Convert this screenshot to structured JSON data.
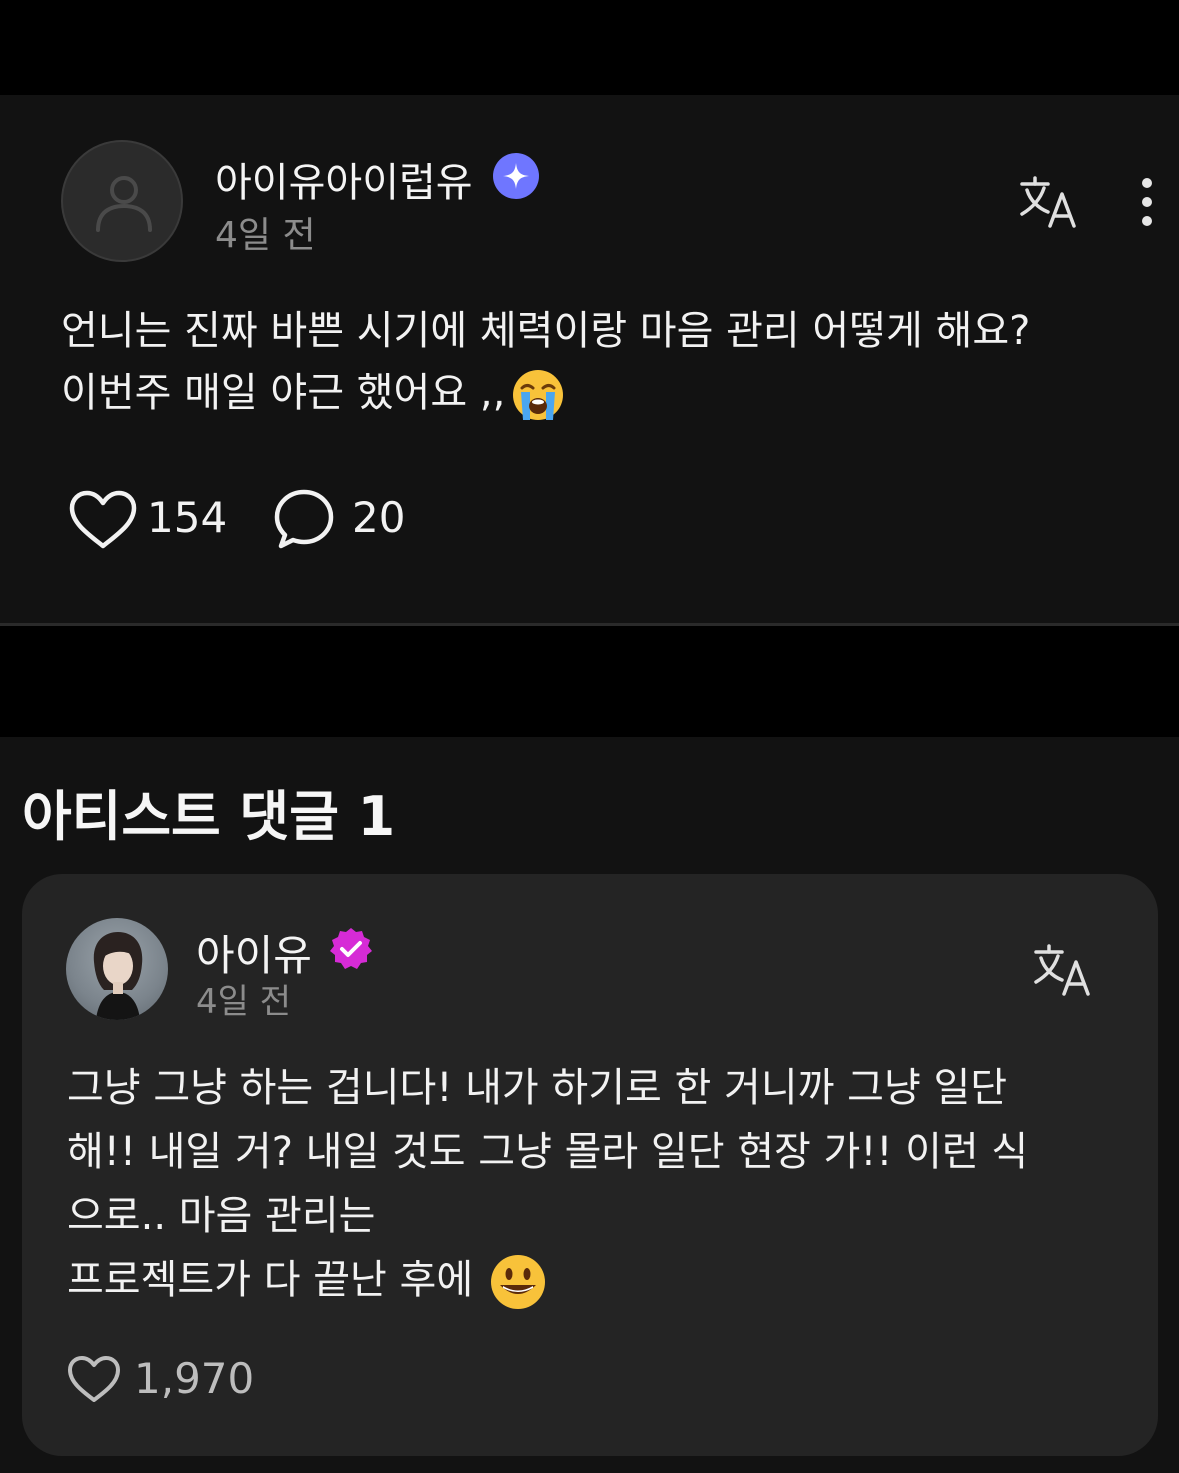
{
  "post": {
    "author": "아이유아이럽유",
    "time": "4일 전",
    "body_lines": [
      "언니는 진짜 바쁜 시기에 체력이랑 마음 관리 어떻게 해요?",
      "이번주 매일 야근 했어요 ,,"
    ],
    "emoji": "loudly-crying-face",
    "likes": "154",
    "comments": "20"
  },
  "artist_section": {
    "title": "아티스트 댓글 1",
    "comment": {
      "author": "아이유",
      "time": "4일 전",
      "body_lines": [
        "그냥 그냥 하는 겁니다! 내가 하기로 한 거니까 그냥 일단",
        "해!! 내일 거? 내일 것도 그냥 몰라 일단 현장 가!! 이런 식",
        "으로.. 마음 관리는",
        "프로젝트가 다 끝난 후에"
      ],
      "emoji": "grinning-face",
      "likes": "1,970"
    }
  },
  "colors": {
    "background": "#000000",
    "card": "#121212",
    "comment_card": "#242424",
    "fan_badge": "#6f76ff",
    "artist_badge": "#d62bd6",
    "muted_text": "#8c8c8c"
  }
}
